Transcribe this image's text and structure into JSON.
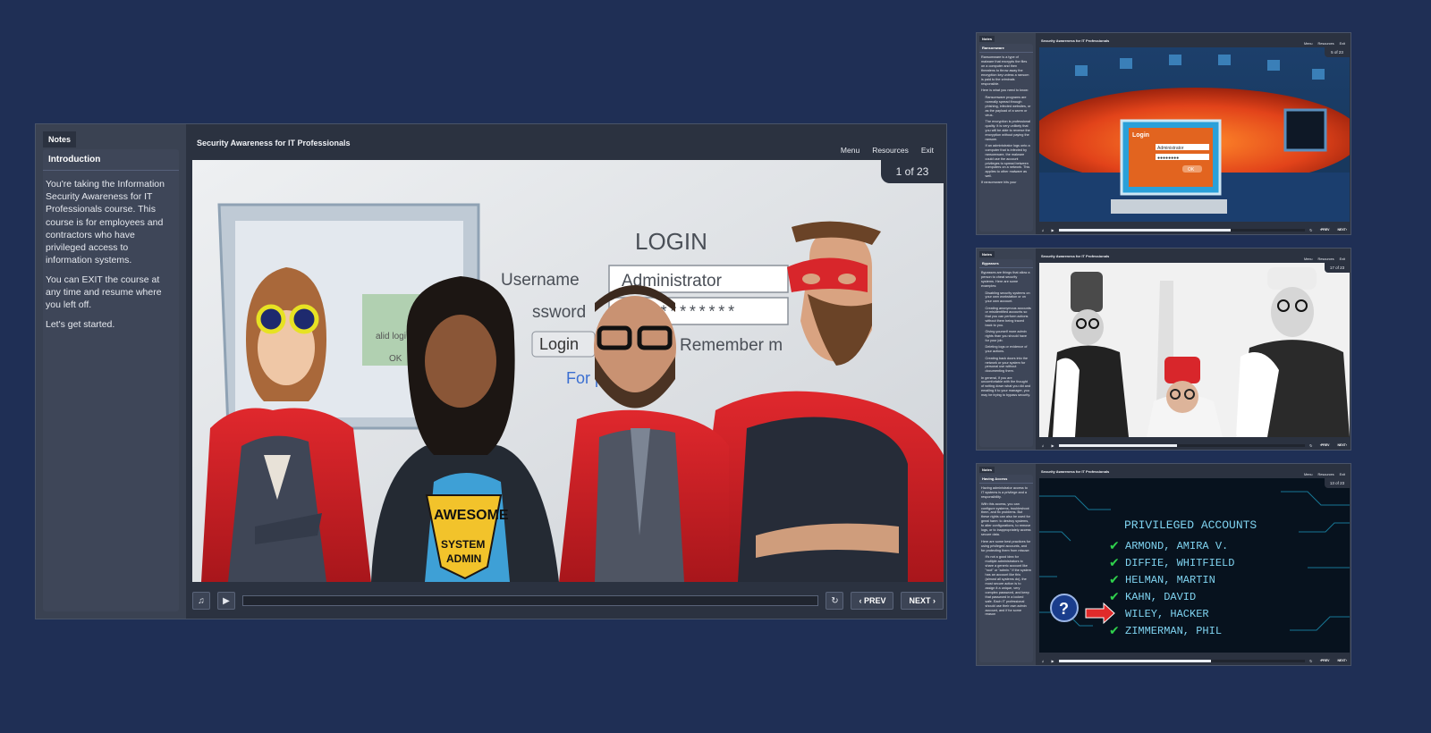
{
  "colors": {
    "background": "#1f2f55",
    "player": "#2b3240",
    "panel": "#3e4658",
    "accent_red": "#d8262b"
  },
  "main": {
    "notes_tab": "Notes",
    "notes_heading": "Introduction",
    "notes_paragraphs": [
      "You're taking the Information Security Awareness for IT Professionals course.    This course is for employees and contractors who have privileged access to information systems.",
      "You can EXIT the course at any time and resume where you left off.",
      "Let's get started."
    ],
    "course_title": "Security Awareness for IT Professionals",
    "menu": [
      "Menu",
      "Resources",
      "Exit"
    ],
    "counter": "1 of 23",
    "slide_text": {
      "login": "LOGIN",
      "username_label": "Username",
      "username_value": "Administrator",
      "password_label": "ssword",
      "password_mask": "**********",
      "login_button": "Login",
      "remember": "Remember m",
      "forgot": "For      password?",
      "invalid": "alid logi",
      "ok": "OK",
      "shirt_line1": "AWESOME",
      "shirt_line2": "SYSTEM",
      "shirt_line3": "ADMIN"
    },
    "progress": 0.0,
    "prev": "PREV",
    "next": "NEXT"
  },
  "thumb1": {
    "notes_tab": "Notes",
    "notes_heading": "Ransomware",
    "notes_paragraphs": [
      "Ransomware is a type of malware that encrypts the files on a computer and then threatens to throw away the encryption key unless a ransom is paid to the criminals responsible.",
      "Here is what you need to know:"
    ],
    "notes_bullets": [
      "Ransomware programs are normally spread through phishing, infected websites, or as the payload of a worm or virus.",
      "The encryption is professional quality. It is very unlikely that you will be able to reverse the encryption without paying the ransom.",
      "If an administrator logs onto a computer that is infected by ransomware, the malware could use the account privileges to spread between computers on a network. This applies to other malware as well."
    ],
    "notes_tail": "If ransomware hits your",
    "course_title": "Security Awareness for IT Professionals",
    "menu": [
      "Menu",
      "Resources",
      "Exit"
    ],
    "counter": "5 of 23",
    "slide_text": {
      "login": "Login",
      "username_value": "Administrator",
      "password_mask": "●●●●●●●●",
      "ok": "OK"
    },
    "progress": 0.7,
    "prev": "PREV",
    "next": "NEXT"
  },
  "thumb2": {
    "notes_tab": "Notes",
    "notes_heading": "Bypasses",
    "notes_paragraphs": [
      "Bypasses are things that allow a person to cheat security systems. Here are some examples:"
    ],
    "notes_bullets": [
      "Disabling security systems on your own workstation or on your own account.",
      "Creating anonymous accounts or misidentified accounts so that you can perform actions without them being traced back to you.",
      "Giving yourself more admin rights than you should have for your job.",
      "Deleting logs or evidence of your actions.",
      "Creating back doors into the network or your system for personal use without documenting them."
    ],
    "notes_tail": "In general, if you are uncomfortable with the thought of writing down what you did and emailing it to your manager, you may be trying to bypass security.",
    "course_title": "Security Awareness for IT Professionals",
    "menu": [
      "Menu",
      "Resources",
      "Exit"
    ],
    "counter": "17 of 23",
    "progress": 0.48,
    "prev": "PREV",
    "next": "NEXT"
  },
  "thumb3": {
    "notes_tab": "Notes",
    "notes_heading": "Having Access",
    "notes_paragraphs": [
      "Having administrator access to IT systems is a privilege and a responsibility.",
      "With this access, you can configure systems, troubleshoot them, and fix problems. But these rights can also be used for great harm: to destroy systems, to alter configurations, to remove logs, or to inappropriately access secure data.",
      "Here are some best practices for using privileged accounts, and for protecting them from misuse:"
    ],
    "notes_bullets": [
      "It's not a good idea for multiple administrators to share a generic account like \"root\" or \"admin.\" If the system has an account like this (almost all systems do), the most secure action is to assign it a unique, very complex password, and keep that password in a locked safe. Each IT professional should use their own admin account, and if for some reason"
    ],
    "notes_tail": "",
    "course_title": "Security Awareness for IT Professionals",
    "menu": [
      "Menu",
      "Resources",
      "Exit"
    ],
    "counter": "13 of 23",
    "slide_text": {
      "heading": "PRIVILEGED ACCOUNTS",
      "accounts": [
        "ARMOND, AMIRA V.",
        "DIFFIE, WHITFIELD",
        "HELMAN, MARTIN",
        "KAHN, DAVID",
        "WILEY, HACKER",
        "ZIMMERMAN, PHIL"
      ],
      "question": "?"
    },
    "progress": 0.62,
    "prev": "PREV",
    "next": "NEXT"
  }
}
